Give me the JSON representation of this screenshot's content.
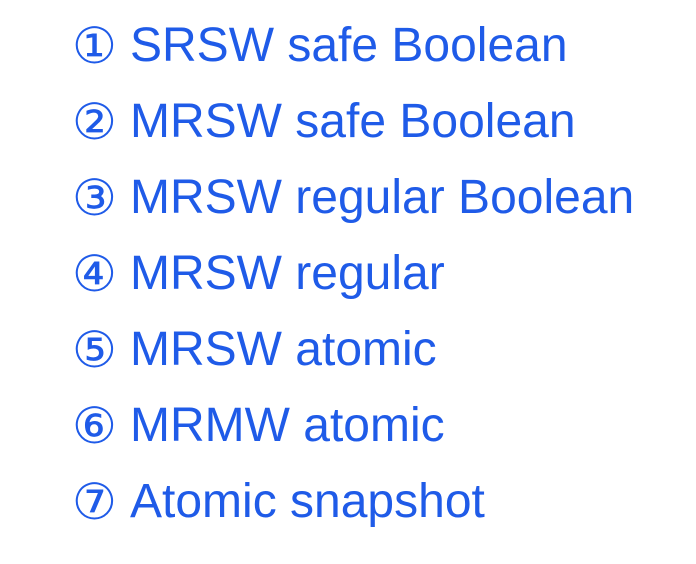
{
  "colors": {
    "text": "#1f5be8",
    "background": "#ffffff"
  },
  "items": [
    {
      "number": "①",
      "label": "SRSW safe Boolean"
    },
    {
      "number": "②",
      "label": "MRSW safe Boolean"
    },
    {
      "number": "③",
      "label": "MRSW regular Boolean"
    },
    {
      "number": "④",
      "label": "MRSW regular"
    },
    {
      "number": "⑤",
      "label": "MRSW atomic"
    },
    {
      "number": "⑥",
      "label": "MRMW atomic"
    },
    {
      "number": "⑦",
      "label": "Atomic snapshot"
    }
  ]
}
